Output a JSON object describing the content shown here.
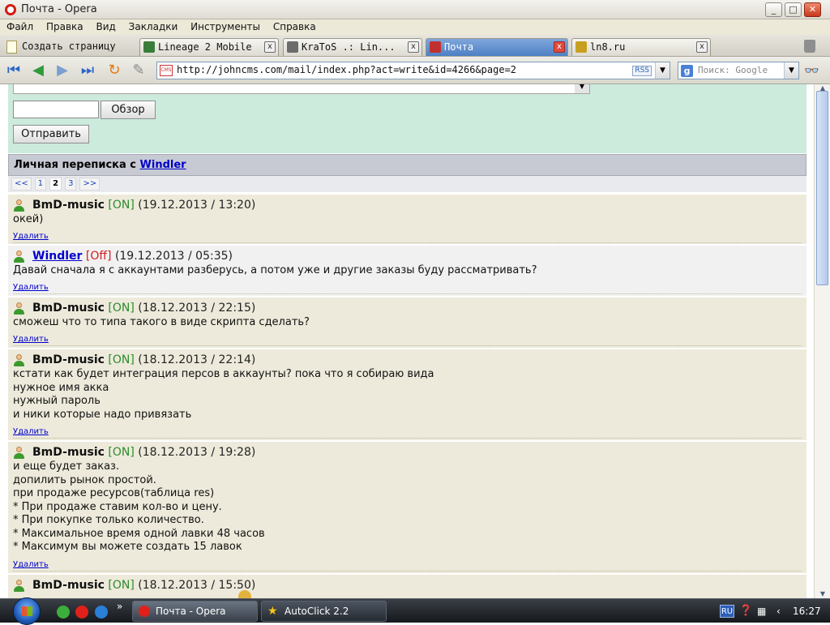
{
  "window": {
    "title": "Почта - Opera",
    "minimize": "_",
    "maximize": "□",
    "close": "✕"
  },
  "menu": [
    "Файл",
    "Правка",
    "Вид",
    "Закладки",
    "Инструменты",
    "Справка"
  ],
  "tabs": {
    "new_page": "Создать страницу",
    "items": [
      {
        "label": "Lineage 2 Mobile",
        "active": false,
        "icon_color": "#3a7d3a"
      },
      {
        "label": "KraToS .: Lin...",
        "active": false,
        "icon_color": "#6c6c6c"
      },
      {
        "label": "Почта",
        "active": true,
        "icon_color": "#c03030"
      },
      {
        "label": "ln8.ru",
        "active": false,
        "icon_color": "#c8a020"
      }
    ],
    "close_glyph": "x"
  },
  "nav": {
    "url": "http://johncms.com/mail/index.php?act=write&id=4266&page=2",
    "rss": "RSS",
    "search_placeholder": "Поиск: Google",
    "cms_badge": "CMS"
  },
  "form": {
    "browse_label": "Обзор",
    "send_label": "Отправить"
  },
  "conversation": {
    "title_prefix": "Личная переписка с",
    "partner": "Windler",
    "pager": [
      "<<",
      "1",
      "2",
      "3",
      ">>"
    ],
    "current_page": "2"
  },
  "messages": [
    {
      "author": "BmD-music",
      "status": "[ON]",
      "datetime": "(19.12.2013 / 13:20)",
      "lines": [
        "окей)"
      ],
      "delete": "Удалить"
    },
    {
      "author": "Windler",
      "status": "[Off]",
      "datetime": "(19.12.2013 / 05:35)",
      "lines": [
        "Давай сначала я с аккаунтами разберусь, а потом уже и другие заказы буду рассматривать?"
      ],
      "delete": "Удалить"
    },
    {
      "author": "BmD-music",
      "status": "[ON]",
      "datetime": "(18.12.2013 / 22:15)",
      "lines": [
        "сможеш что то типа такого в виде скрипта сделать?"
      ],
      "delete": "Удалить"
    },
    {
      "author": "BmD-music",
      "status": "[ON]",
      "datetime": "(18.12.2013 / 22:14)",
      "lines": [
        "кстати как будет интеграция персов в аккаунты? пока что я собираю вида",
        "нужное имя акка",
        "нужный пароль",
        "и ники которые надо привязать"
      ],
      "delete": "Удалить"
    },
    {
      "author": "BmD-music",
      "status": "[ON]",
      "datetime": "(18.12.2013 / 19:28)",
      "lines": [
        "и еще будет заказ.",
        "допилить рынок простой.",
        "при продаже ресурсов(таблица res)",
        "* При продаже ставим кол-во и цену.",
        "* При покупке только количество.",
        "* Максимальное время одной лавки 48 часов",
        "* Максимум вы можете создать 15 лавок"
      ],
      "delete": "Удалить"
    },
    {
      "author": "BmD-music",
      "status": "[ON]",
      "datetime": "(18.12.2013 / 15:50)",
      "lines": [],
      "delete": ""
    }
  ],
  "taskbar": {
    "tasks": [
      "Почта - Opera",
      "AutoClick 2.2"
    ],
    "lang": "RU",
    "time": "16:27",
    "quick_arrow": "»"
  },
  "colors": {
    "form_bg": "#ccebdd",
    "message_bg": "#edeadb",
    "online": "#2e8b2e",
    "offline": "#d02020",
    "link": "#0000cc"
  }
}
